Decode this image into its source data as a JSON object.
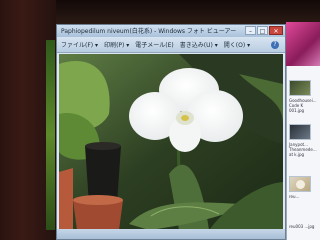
{
  "window": {
    "title": "Paphiopedilum niveum(白花系) - Windows フォト ビューアー",
    "controls": {
      "minimize": "–",
      "maximize": "□",
      "close": "✕"
    }
  },
  "menu": {
    "items": [
      {
        "label": "ファイル(F) ▾"
      },
      {
        "label": "印刷(P) ▾"
      },
      {
        "label": "電子メール(E)"
      },
      {
        "label": "書き込み(U) ▾"
      },
      {
        "label": "開く(O) ▾"
      }
    ],
    "help": "?"
  },
  "side_panel": {
    "items": [
      {
        "label": "Goodhousei... Code K 001.jpg"
      },
      {
        "label": "Janypot... Theanmede... at k.jpg"
      },
      {
        "label": "reu..."
      },
      {
        "label": "reu003 ...jpg"
      }
    ]
  },
  "colors": {
    "accent": "#a9c1da",
    "close": "#c9463d"
  }
}
